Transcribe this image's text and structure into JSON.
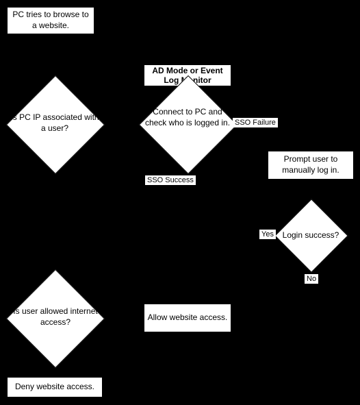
{
  "nodes": {
    "start": "PC tries to browse to a website.",
    "q_ip_user": "Is PC IP associated with a user?",
    "sso_header": "AD Mode or Event Log Monitor",
    "sso_check": "Connect to PC and check who is logged in.",
    "prompt": "Prompt user to manually log in.",
    "q_login": "Login success?",
    "q_allowed": "Is user allowed internet access?",
    "allow": "Allow website access.",
    "deny": "Deny website access."
  },
  "labels": {
    "sso_failure": "SSO Failure",
    "sso_success": "SSO Success",
    "yes": "Yes",
    "no": "No"
  }
}
